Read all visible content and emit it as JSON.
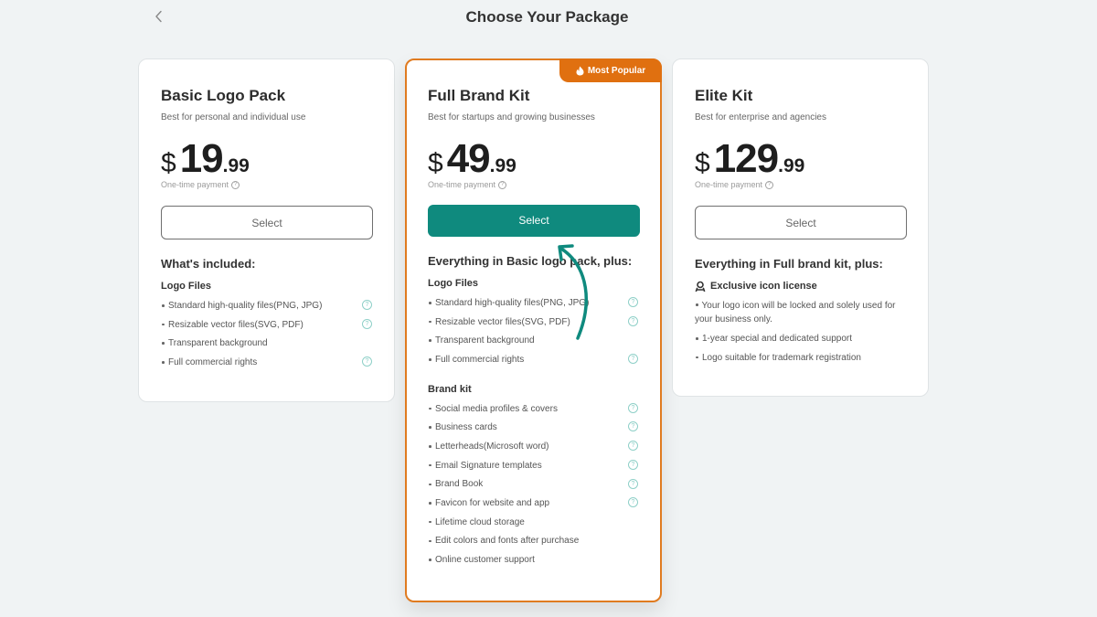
{
  "header": {
    "title": "Choose Your Package",
    "back_icon": "chevron-left-icon"
  },
  "colors": {
    "accent_teal": "#0f8a7e",
    "popular_orange": "#e07010",
    "background": "#f0f3f4"
  },
  "plans": [
    {
      "name": "Basic Logo Pack",
      "description": "Best for personal and individual use",
      "currency": "$",
      "price_whole": "19",
      "price_cents": ".99",
      "payment_note": "One-time payment",
      "select_label": "Select",
      "section_heading": "What's included:",
      "groups": [
        {
          "title": "Logo Files",
          "features": [
            {
              "text": "Standard high-quality files(PNG, JPG)",
              "info": true
            },
            {
              "text": "Resizable vector files(SVG, PDF)",
              "info": true
            },
            {
              "text": "Transparent background",
              "info": false
            },
            {
              "text": "Full commercial rights",
              "info": true
            }
          ]
        }
      ]
    },
    {
      "name": "Full Brand Kit",
      "badge": "Most Popular",
      "badge_icon": "flame-icon",
      "description": "Best for startups and growing businesses",
      "currency": "$",
      "price_whole": "49",
      "price_cents": ".99",
      "payment_note": "One-time payment",
      "select_label": "Select",
      "section_heading": "Everything in Basic logo pack, plus:",
      "groups": [
        {
          "title": "Logo Files",
          "features": [
            {
              "text": "Standard high-quality files(PNG, JPG)",
              "info": true
            },
            {
              "text": "Resizable vector files(SVG, PDF)",
              "info": true
            },
            {
              "text": "Transparent background",
              "info": false
            },
            {
              "text": "Full commercial rights",
              "info": true
            }
          ]
        },
        {
          "title": "Brand kit",
          "features": [
            {
              "text": "Social media profiles & covers",
              "info": true
            },
            {
              "text": "Business cards",
              "info": true
            },
            {
              "text": "Letterheads(Microsoft word)",
              "info": true
            },
            {
              "text": "Email Signature templates",
              "info": true
            },
            {
              "text": "Brand Book",
              "info": true
            },
            {
              "text": "Favicon for website and app",
              "info": true
            },
            {
              "text": "Lifetime cloud storage",
              "info": false
            },
            {
              "text": "Edit colors and fonts after purchase",
              "info": false
            },
            {
              "text": "Online customer support",
              "info": false
            }
          ]
        }
      ]
    },
    {
      "name": "Elite Kit",
      "description": "Best for enterprise and agencies",
      "currency": "$",
      "price_whole": "129",
      "price_cents": ".99",
      "payment_note": "One-time payment",
      "select_label": "Select",
      "section_heading": "Everything in Full brand kit, plus:",
      "groups": [
        {
          "title": "Exclusive icon license",
          "icon": "user-badge-icon",
          "features": [
            {
              "text": "Your logo icon will be locked and solely used for your business only.",
              "info": false
            },
            {
              "text": "1-year special and dedicated support",
              "info": false
            },
            {
              "text": "Logo suitable for trademark registration",
              "info": false
            }
          ]
        }
      ]
    }
  ]
}
